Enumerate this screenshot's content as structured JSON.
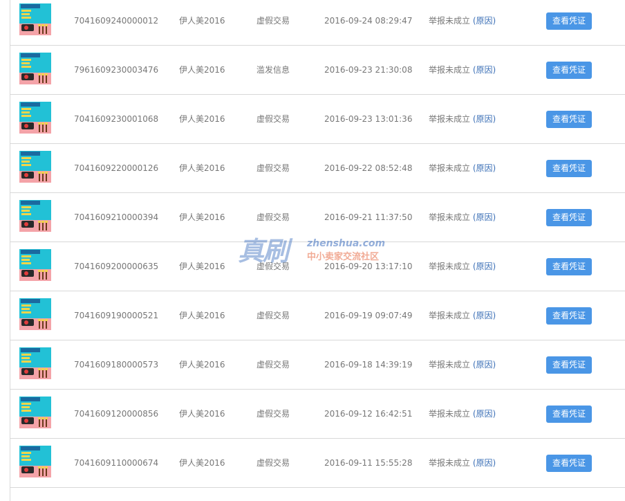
{
  "button_label": "查看凭证",
  "reason_label": "(原因)",
  "watermark": {
    "big": "真刷",
    "url": "zhenshua.com",
    "sub": "中小卖家交流社区"
  },
  "rows": [
    {
      "order": "7041609240000012",
      "shop": "伊人美2016",
      "type": "虚假交易",
      "time": "2016-09-24 08:29:47",
      "status": "举报未成立"
    },
    {
      "order": "7961609230003476",
      "shop": "伊人美2016",
      "type": "滥发信息",
      "time": "2016-09-23 21:30:08",
      "status": "举报未成立"
    },
    {
      "order": "7041609230001068",
      "shop": "伊人美2016",
      "type": "虚假交易",
      "time": "2016-09-23 13:01:36",
      "status": "举报未成立"
    },
    {
      "order": "7041609220000126",
      "shop": "伊人美2016",
      "type": "虚假交易",
      "time": "2016-09-22 08:52:48",
      "status": "举报未成立"
    },
    {
      "order": "7041609210000394",
      "shop": "伊人美2016",
      "type": "虚假交易",
      "time": "2016-09-21 11:37:50",
      "status": "举报未成立"
    },
    {
      "order": "7041609200000635",
      "shop": "伊人美2016",
      "type": "虚假交易",
      "time": "2016-09-20 13:17:10",
      "status": "举报未成立"
    },
    {
      "order": "7041609190000521",
      "shop": "伊人美2016",
      "type": "虚假交易",
      "time": "2016-09-19 09:07:49",
      "status": "举报未成立"
    },
    {
      "order": "7041609180000573",
      "shop": "伊人美2016",
      "type": "虚假交易",
      "time": "2016-09-18 14:39:19",
      "status": "举报未成立"
    },
    {
      "order": "7041609120000856",
      "shop": "伊人美2016",
      "type": "虚假交易",
      "time": "2016-09-12 16:42:51",
      "status": "举报未成立"
    },
    {
      "order": "7041609110000674",
      "shop": "伊人美2016",
      "type": "虚假交易",
      "time": "2016-09-11 15:55:28",
      "status": "举报未成立"
    }
  ]
}
